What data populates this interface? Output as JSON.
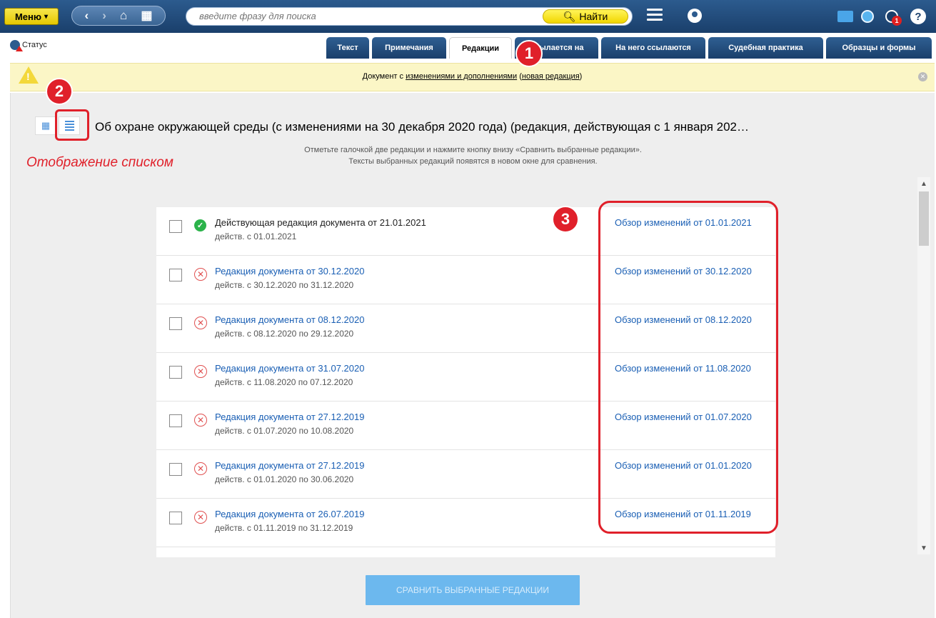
{
  "topbar": {
    "menu_label": "Меню",
    "search_placeholder": "введите фразу для поиска",
    "search_button": "Найти",
    "alert_count": "1"
  },
  "status_label": "Статус",
  "tabs": [
    {
      "label": "Текст"
    },
    {
      "label": "Примечания"
    },
    {
      "label": "Редакции"
    },
    {
      "label": "Ссылается на"
    },
    {
      "label": "На него ссылаются"
    },
    {
      "label": "Судебная практика"
    },
    {
      "label": "Образцы и формы"
    }
  ],
  "banner": {
    "prefix": "Документ с ",
    "link1": "изменениями и дополнениями",
    "middle": " (",
    "link2": "новая редакция",
    "suffix": ")"
  },
  "document_title": "Об охране окружающей среды (с изменениями на 30 декабря 2020 года) (редакция, действующая с 1 января 202…",
  "hint_line1": "Отметьте галочкой две редакции и нажмите кнопку внизу «Сравнить выбранные редакции».",
  "hint_line2": "Тексты выбранных редакций появятся в новом окне для сравнения.",
  "list_caption": "Отображение списком",
  "editions": [
    {
      "title": "Действующая редакция документа от 21.01.2021",
      "period": "действ. с 01.01.2021",
      "review": "Обзор изменений от 01.01.2021"
    },
    {
      "title": "Редакция документа от 30.12.2020",
      "period": "действ. с 30.12.2020 по 31.12.2020",
      "review": "Обзор изменений от 30.12.2020"
    },
    {
      "title": "Редакция документа от 08.12.2020",
      "period": "действ. с 08.12.2020 по 29.12.2020",
      "review": "Обзор изменений от 08.12.2020"
    },
    {
      "title": "Редакция документа от 31.07.2020",
      "period": "действ. с 11.08.2020 по 07.12.2020",
      "review": "Обзор изменений от 11.08.2020"
    },
    {
      "title": "Редакция документа от 27.12.2019",
      "period": "действ. с 01.07.2020 по 10.08.2020",
      "review": "Обзор изменений от 01.07.2020"
    },
    {
      "title": "Редакция документа от 27.12.2019",
      "period": "действ. с 01.01.2020 по 30.06.2020",
      "review": "Обзор изменений от 01.01.2020"
    },
    {
      "title": "Редакция документа от 26.07.2019",
      "period": "действ. с 01.11.2019 по 31.12.2019",
      "review": "Обзор изменений от 01.11.2019"
    }
  ],
  "compare_button": "СРАВНИТЬ ВЫБРАННЫЕ РЕДАКЦИИ",
  "callouts": [
    "1",
    "2",
    "3"
  ],
  "colors": {
    "header_blue": "#1a3f6b",
    "accent_yellow": "#f1d600",
    "link_blue": "#1a5fb4",
    "callout_red": "#e0202a",
    "ok_green": "#2bb34a",
    "compare_button": "#6cb8ee"
  }
}
